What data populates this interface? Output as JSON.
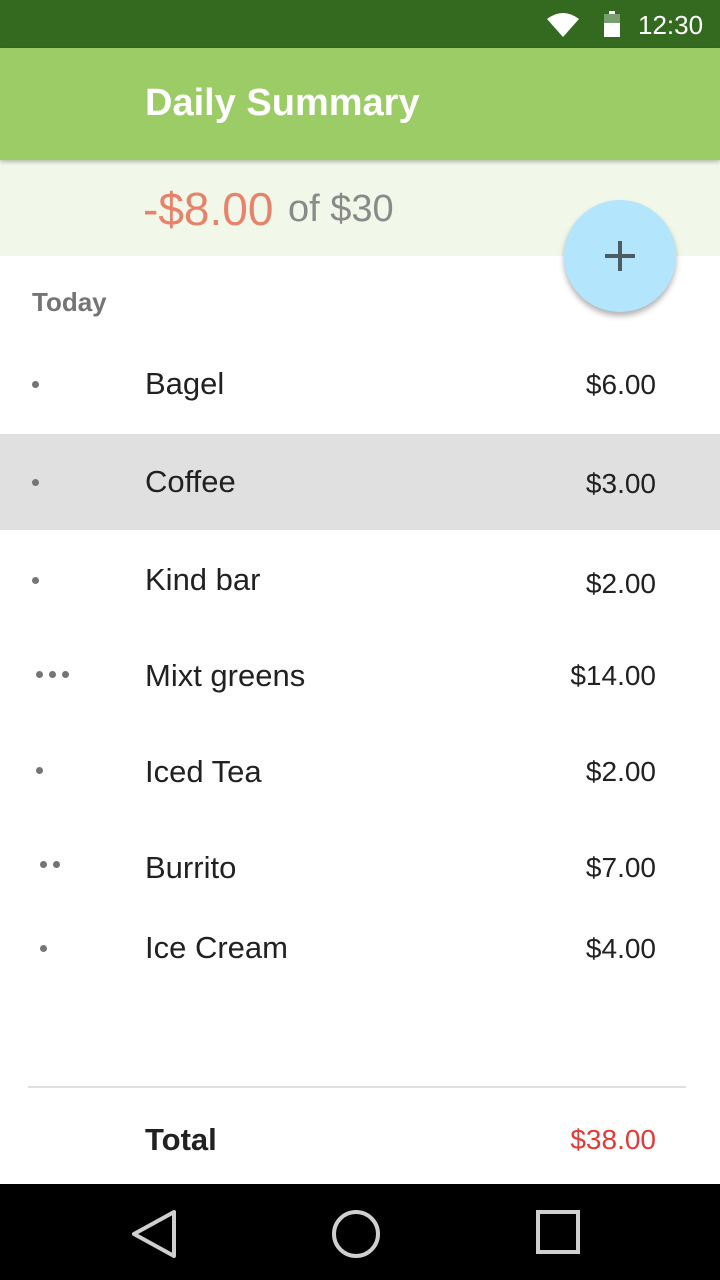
{
  "status_bar": {
    "time": "12:30"
  },
  "app_bar": {
    "title": "Daily Summary"
  },
  "summary": {
    "spent": "-$8.00",
    "of_budget": "of $30"
  },
  "section": {
    "label": "Today"
  },
  "items": [
    {
      "name": "Bagel",
      "amount": "$6.00",
      "dots": 1
    },
    {
      "name": "Coffee",
      "amount": "$3.00",
      "dots": 1,
      "selected": true
    },
    {
      "name": "Kind bar",
      "amount": "$2.00",
      "dots": 1
    },
    {
      "name": "Mixt greens",
      "amount": "$14.00",
      "dots": 3
    },
    {
      "name": "Iced Tea",
      "amount": "$2.00",
      "dots": 1
    },
    {
      "name": "Burrito",
      "amount": "$7.00",
      "dots": 2
    },
    {
      "name": "Ice Cream",
      "amount": "$4.00",
      "dots": 1
    }
  ],
  "total": {
    "label": "Total",
    "value": "$38.00"
  },
  "colors": {
    "status_bar": "#346a20",
    "app_bar": "#9ccc65",
    "summary_bg": "#f1f8e9",
    "spent": "#e8836b",
    "fab": "#b3e5fc",
    "total_value": "#e53935"
  },
  "icons": {
    "fab": "plus-icon",
    "status": [
      "wifi-icon",
      "battery-icon"
    ],
    "nav": [
      "back-icon",
      "home-icon",
      "recents-icon"
    ]
  }
}
